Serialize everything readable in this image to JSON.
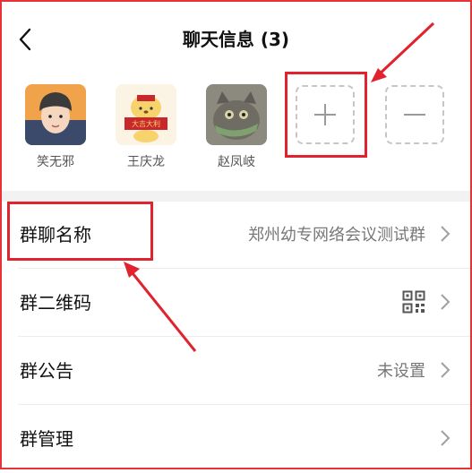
{
  "header": {
    "back_icon": "chevron-left-icon",
    "title": "聊天信息 (3)"
  },
  "members": [
    {
      "name": "笑无邪"
    },
    {
      "name": "王庆龙",
      "avatar_text": "大吉大利"
    },
    {
      "name": "赵凤岐"
    }
  ],
  "actions": {
    "add_icon": "plus-icon",
    "remove_icon": "minus-icon"
  },
  "settings": [
    {
      "label": "群聊名称",
      "value": "郑州幼专网络会议测试群"
    },
    {
      "label": "群二维码",
      "icon": "qr-code-icon"
    },
    {
      "label": "群公告",
      "value": "未设置"
    },
    {
      "label": "群管理"
    }
  ],
  "colors": {
    "highlight": "#e0232e",
    "separator": "#f2f2f2",
    "secondary_text": "#777777"
  }
}
